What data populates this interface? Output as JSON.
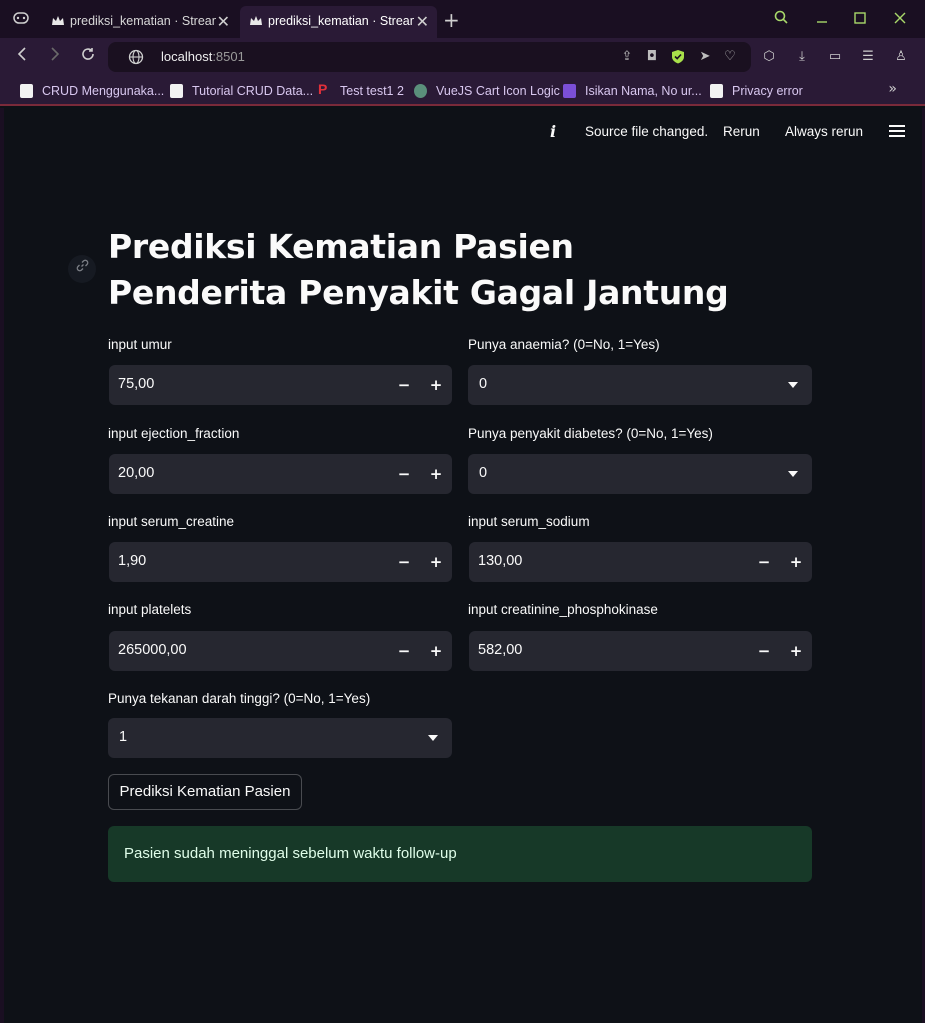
{
  "browser": {
    "tabs": [
      {
        "title": "prediksi_kematian · Streamlit",
        "active": false
      },
      {
        "title": "prediksi_kematian · Streamlit",
        "active": true
      }
    ],
    "url_host": "localhost",
    "url_port": ":8501",
    "bookmarks": [
      {
        "label": "CRUD Menggunaka...",
        "icon": "page-icon"
      },
      {
        "label": "Tutorial CRUD Data...",
        "icon": "page-icon"
      },
      {
        "label": "Test test1 2",
        "icon": "p-logo-icon"
      },
      {
        "label": "VueJS Cart Icon Logic",
        "icon": "openai-icon"
      },
      {
        "label": "Isikan Nama, No ur...",
        "icon": "form-icon"
      },
      {
        "label": "Privacy error",
        "icon": "page-icon"
      }
    ],
    "more_bookmarks": "»"
  },
  "streamlit_header": {
    "info_icon": "i",
    "message": "Source file changed.",
    "rerun": "Rerun",
    "always_rerun": "Always rerun"
  },
  "page": {
    "title": "Prediksi Kematian Pasien Penderita Penyakit Gagal Jantung",
    "fields": {
      "umur": {
        "label": "input umur",
        "value": "75,00"
      },
      "anaemia": {
        "label": "Punya anaemia? (0=No, 1=Yes)",
        "value": "0"
      },
      "ejection_fraction": {
        "label": "input ejection_fraction",
        "value": "20,00"
      },
      "diabetes": {
        "label": "Punya penyakit diabetes? (0=No, 1=Yes)",
        "value": "0"
      },
      "serum_creatine": {
        "label": "input serum_creatine",
        "value": "1,90"
      },
      "serum_sodium": {
        "label": "input serum_sodium",
        "value": "130,00"
      },
      "platelets": {
        "label": "input platelets",
        "value": "265000,00"
      },
      "creatinine_phosphokinase": {
        "label": "input creatinine_phosphokinase",
        "value": "582,00"
      },
      "tekanan_darah": {
        "label": "Punya tekanan darah tinggi? (0=No, 1=Yes)",
        "value": "1"
      }
    },
    "stepper_minus": "−",
    "stepper_plus": "+",
    "predict_button": "Prediksi Kematian Pasien",
    "result": "Pasien sudah meninggal sebelum waktu follow-up"
  },
  "colors": {
    "background": "#0e1117",
    "input_bg": "#262730",
    "success_bg": "#173928",
    "success_text": "#dffde9",
    "browser_chrome": "#2a1a36"
  }
}
